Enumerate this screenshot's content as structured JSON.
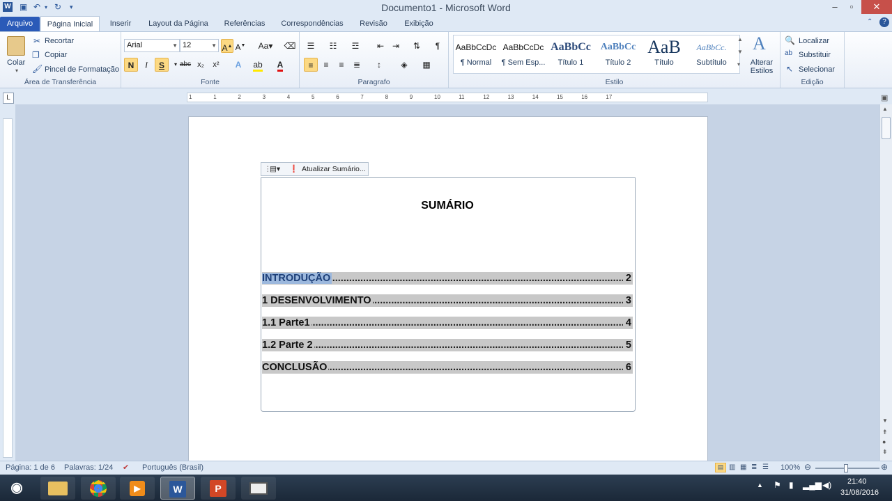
{
  "window": {
    "title": "Documento1  -  Microsoft Word"
  },
  "qat": {
    "word_icon": "W"
  },
  "tabs": [
    "Arquivo",
    "Página Inicial",
    "Inserir",
    "Layout da Página",
    "Referências",
    "Correspondências",
    "Revisão",
    "Exibição"
  ],
  "clipboard": {
    "paste": "Colar",
    "cut": "Recortar",
    "copy": "Copiar",
    "format_painter": "Pincel de Formatação",
    "group": "Área de Transferência"
  },
  "font": {
    "name": "Arial",
    "size": "12",
    "group": "Fonte",
    "bold": "N",
    "italic": "I",
    "underline": "S",
    "strike": "abc"
  },
  "paragraph": {
    "group": "Paragrafo"
  },
  "styles": {
    "group": "Estilo",
    "items": [
      {
        "preview": "AaBbCcDc",
        "name": "¶ Normal"
      },
      {
        "preview": "AaBbCcDc",
        "name": "¶ Sem Esp..."
      },
      {
        "preview": "AaBbCc",
        "name": "Título 1"
      },
      {
        "preview": "AaBbCc",
        "name": "Título 2"
      },
      {
        "preview": "AaB",
        "name": "Título"
      },
      {
        "preview": "AaBbCc.",
        "name": "Subtítulo"
      }
    ],
    "change": "Alterar Estilos"
  },
  "editing": {
    "find": "Localizar",
    "replace": "Substituir",
    "select": "Selecionar",
    "group": "Edição"
  },
  "ruler": {
    "marks": [
      "1",
      "1",
      "2",
      "3",
      "4",
      "5",
      "6",
      "7",
      "8",
      "9",
      "10",
      "11",
      "12",
      "13",
      "14",
      "15",
      "16",
      "17"
    ]
  },
  "toc": {
    "update_button": "Atualizar Sumário...",
    "title": "SUMÁRIO",
    "entries": [
      {
        "text": "INTRODUÇÃO",
        "page": "2"
      },
      {
        "text": "1 DESENVOLVIMENTO",
        "page": "3"
      },
      {
        "text": "1.1 Parte1",
        "page": "4"
      },
      {
        "text": "1.2 Parte 2",
        "page": "5"
      },
      {
        "text": "CONCLUSÃO",
        "page": "6"
      }
    ]
  },
  "status": {
    "page": "Página: 1 de 6",
    "words": "Palavras: 1/24",
    "language": "Português (Brasil)",
    "zoom": "100%"
  },
  "taskbar": {
    "time": "21:40",
    "date": "31/08/2016"
  }
}
